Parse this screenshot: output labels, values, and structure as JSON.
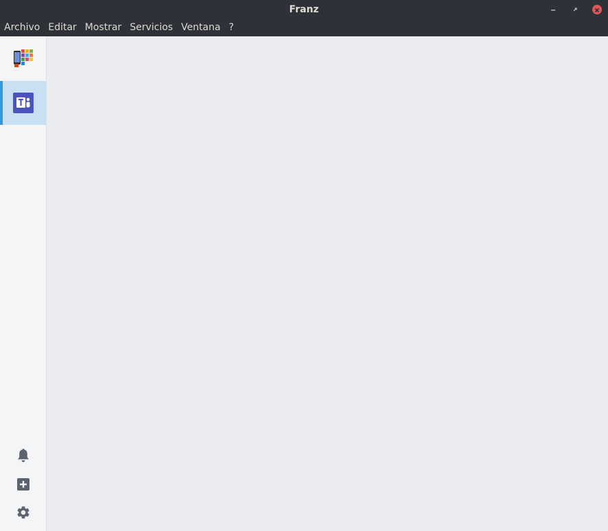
{
  "window": {
    "title": "Franz"
  },
  "menubar": {
    "items": [
      "Archivo",
      "Editar",
      "Mostrar",
      "Servicios",
      "Ventana",
      "?"
    ]
  },
  "sidebar": {
    "services": [
      {
        "icon": "app-grid-icon",
        "active": false
      },
      {
        "icon": "microsoft-teams-icon",
        "active": true
      }
    ],
    "bottom_icons": [
      "bell-icon",
      "add-service-icon",
      "settings-gear-icon"
    ]
  },
  "colors": {
    "titlebar": "#2e3138",
    "sidebar": "#f4f5f7",
    "active_service_bg": "#c9dff2",
    "active_indicator": "#3498db",
    "content": "#ebecef",
    "close_button": "#e2555b",
    "teams_purple": "#4b53bc"
  }
}
